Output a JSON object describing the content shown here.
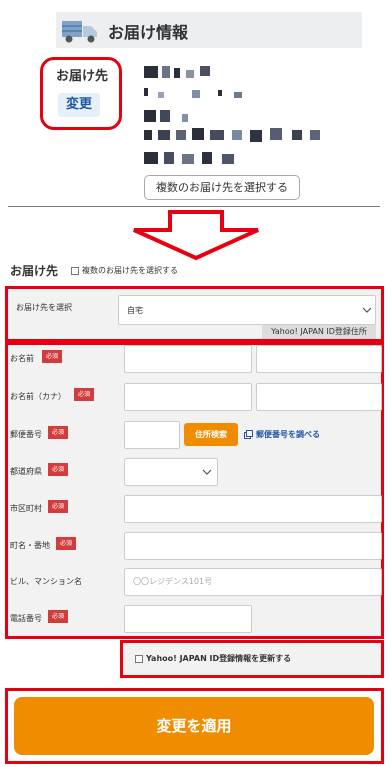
{
  "header": {
    "title": "お届け情報",
    "truck_icon": "truck-icon"
  },
  "current": {
    "label": "お届け先",
    "change_button": "変更"
  },
  "multi_button": "複数のお届け先を選択する",
  "form": {
    "title": "お届け先",
    "multi_checkbox_label": "複数のお届け先を選択する",
    "select_label": "お届け先を選択",
    "select_value": "自宅",
    "select_note": "Yahoo! JAPAN ID登録住所",
    "required": "必須",
    "name_label": "お名前",
    "kana_label": "お名前（カナ）",
    "postal_label": "郵便番号",
    "search_button": "住所検索",
    "postal_link": "郵便番号を調べる",
    "pref_label": "都道府県",
    "city_label": "市区町村",
    "street_label": "町名・番地",
    "building_label": "ビル、マンション名",
    "building_placeholder": "〇〇レジデンス101号",
    "phone_label": "電話番号",
    "update_checkbox_label": "Yahoo! JAPAN ID登録情報を更新する"
  },
  "apply_button": "変更を適用",
  "colors": {
    "accent": "#f08c00",
    "highlight": "#e60012",
    "link": "#2256a5",
    "required": "#d23c3c"
  }
}
